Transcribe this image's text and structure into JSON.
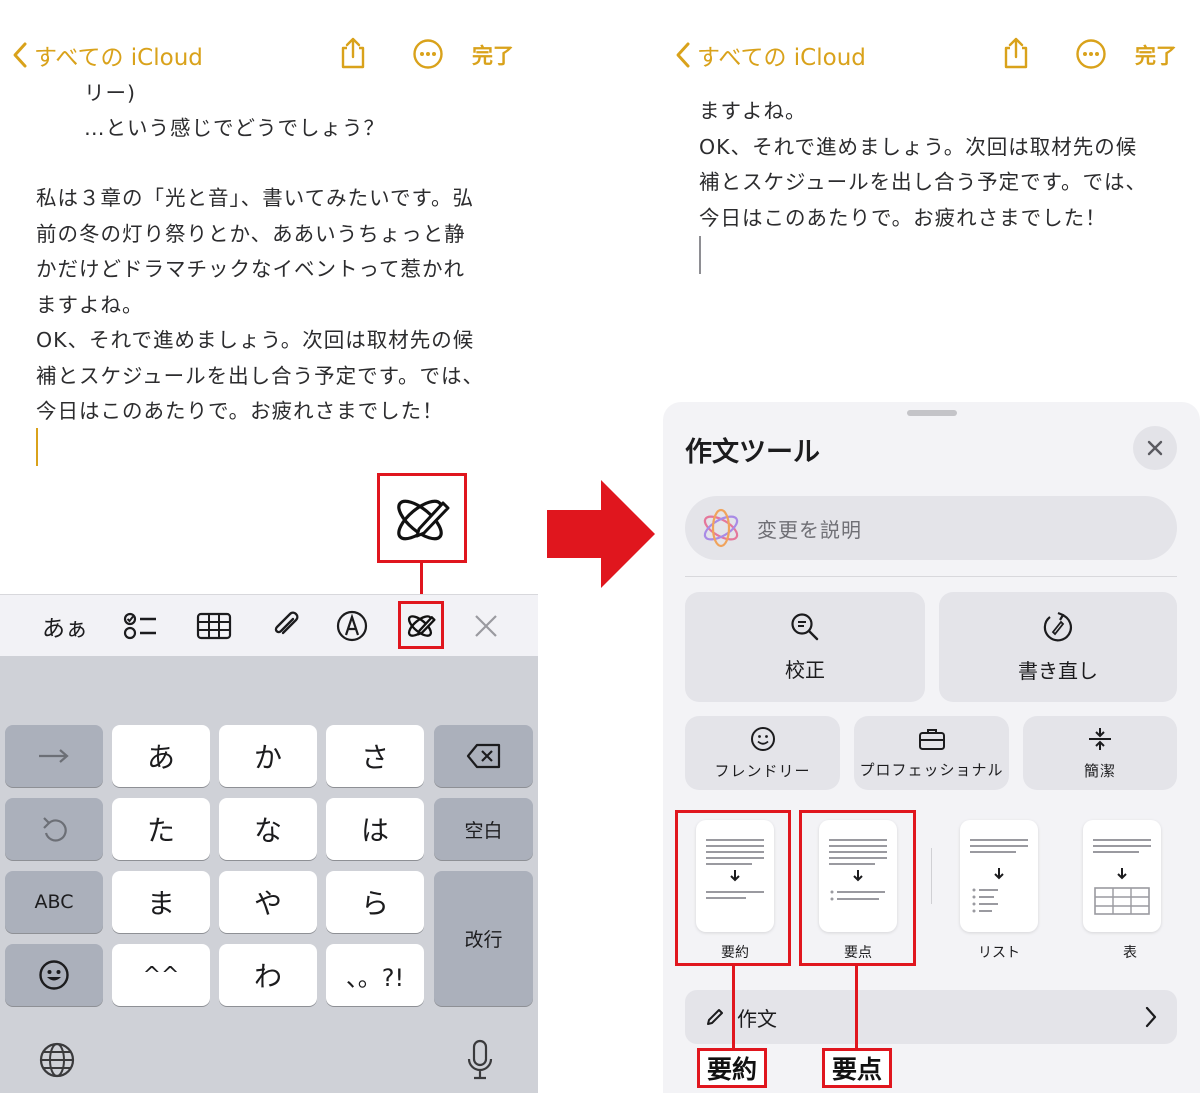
{
  "colors": {
    "accent": "#d9a21b",
    "annotation": "#e0161e"
  },
  "left": {
    "nav": {
      "back_label": "すべての iCloud",
      "done_label": "完了"
    },
    "note_top": [
      "リー)",
      "…という感じでどうでしょう？"
    ],
    "note_lines": [
      "私は３章の「光と音」、書いてみたいです。弘",
      "前の冬の灯り祭りとか、ああいうちょっと静",
      "かだけどドラマチックなイベントって惹かれ",
      "ますよね。",
      "OK、それで進めましょう。次回は取材先の候",
      "補とスケジュールを出し合う予定です。では、",
      "今日はこのあたりで。お疲れさまでした！"
    ],
    "toolbar": {
      "kana_label": "あぁ"
    },
    "keyboard": {
      "rows": [
        [
          "あ",
          "か",
          "さ"
        ],
        [
          "た",
          "な",
          "は"
        ],
        [
          "ま",
          "や",
          "ら"
        ],
        [
          "^^",
          "わ",
          "、。?!"
        ]
      ],
      "space_label": "空白",
      "abc_label": "ABC",
      "return_label": "改行"
    }
  },
  "right": {
    "nav": {
      "back_label": "すべての iCloud",
      "done_label": "完了"
    },
    "note_lines": [
      "ますよね。",
      "OK、それで進めましょう。次回は取材先の候",
      "補とスケジュールを出し合う予定です。では、",
      "今日はこのあたりで。お疲れさまでした！"
    ],
    "sheet": {
      "title": "作文ツール",
      "describe_placeholder": "変更を説明",
      "proofread": "校正",
      "rewrite": "書き直し",
      "friendly": "フレンドリー",
      "professional": "プロフェッショナル",
      "concise": "簡潔",
      "summary": "要約",
      "key_points": "要点",
      "list": "リスト",
      "table": "表",
      "compose": "作文"
    },
    "annotations": {
      "summary_label": "要約",
      "key_points_label": "要点"
    }
  }
}
